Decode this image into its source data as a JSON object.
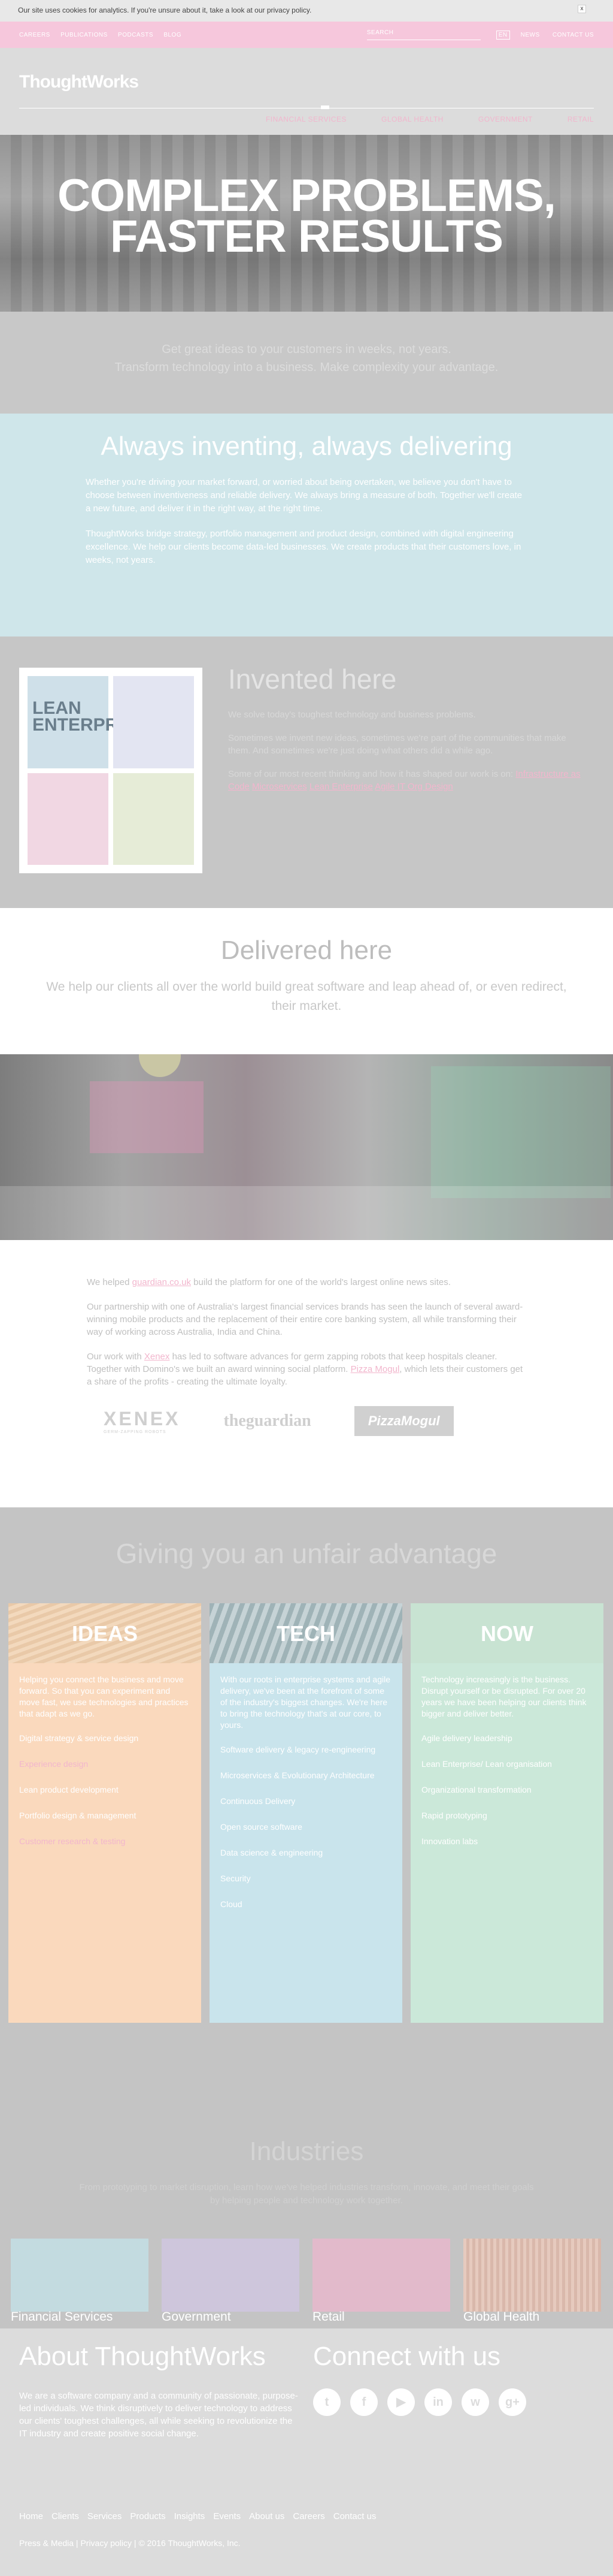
{
  "cookie": {
    "text": "Our site uses cookies for analytics. If you're unsure about it, take a look at our privacy policy.",
    "close": "x"
  },
  "topbar": {
    "left": [
      "Careers",
      "Publications",
      "Podcasts",
      "Blog"
    ],
    "search_placeholder": "Search",
    "right": [
      "News",
      "Contact us"
    ],
    "lang": "EN"
  },
  "header": {
    "logo": "ThoughtWorks",
    "nav": [
      "Financial Services",
      "Global Health",
      "Government",
      "Retail"
    ]
  },
  "hero": {
    "title_line1": "COMPLEX PROBLEMS,",
    "title_line2": "FASTER RESULTS"
  },
  "intro": {
    "line1": "Get great ideas to your customers in weeks, not years.",
    "line2": "Transform technology into a business. Make complexity your advantage."
  },
  "inventing": {
    "title": "Always inventing, always delivering",
    "p1": "Whether you're driving your market forward, or worried about being overtaken, we believe you don't have to choose between inventiveness and reliable delivery. We always bring a measure of both. Together we'll create a new future, and deliver it in the right way, at the right time.",
    "p2": "ThoughtWorks bridge strategy, portfolio management and product design, combined with digital engineering excellence. We help our clients become data-led businesses. We create products that their customers love, in weeks, not years."
  },
  "invented": {
    "title": "Invented here",
    "p1": "We solve today's toughest technology and business problems.",
    "p2": "Sometimes we invent new ideas, sometimes we're part of the communities that make them. And sometimes we're just doing what others did a while ago.",
    "p3": "Some of our most recent thinking and how it has shaped our work is on:",
    "links": [
      "Infrastructure as Code",
      "Microservices",
      "Lean Enterprise",
      "Agile IT Org Design"
    ],
    "book_title": "LEAN ENTERPRISE"
  },
  "delivered": {
    "title": "Delivered here",
    "text": "We help our clients all over the world build great software and leap ahead of, or even redirect, their market."
  },
  "clients": {
    "p1_pre": "We helped ",
    "p1_link": "guardian.co.uk",
    "p1_post": " build the platform for one of the world's largest online news sites.",
    "p2": "Our partnership with one of Australia's largest financial services brands has seen the launch of several award-winning mobile products and the replacement of their entire core banking system, all while transforming their way of working across Australia, India and China.",
    "p3_pre": "Our work with ",
    "p3_link1": "Xenex",
    "p3_mid": " has led to software advances for germ zapping robots that keep hospitals cleaner. Together with Domino's we built an award winning social platform. ",
    "p3_link2": "Pizza Mogul",
    "p3_post": ", which lets their customers get a share of the profits - creating the ultimate loyalty.",
    "logos": {
      "xenex": "XENEX",
      "xenex_sub": "GERM-ZAPPING ROBOTS",
      "guardian": "theguardian",
      "pizza": "PizzaMogul"
    }
  },
  "advantage": {
    "title": "Giving you an unfair advantage",
    "cards": [
      {
        "title": "IDEAS",
        "intro": "Helping you connect the business and move forward. So that you can experiment and move fast, we use technologies and practices that adapt as we go.",
        "items": [
          "Digital strategy & service design",
          "Experience design",
          "Lean product development",
          "Portfolio design & management",
          "Customer research & testing"
        ]
      },
      {
        "title": "TECH",
        "intro": "With our roots in enterprise systems and agile delivery, we've been at the forefront of some of the industry's biggest changes. We're here to bring the technology that's at our core, to yours.",
        "items": [
          "Software delivery & legacy re-engineering",
          "Microservices & Evolutionary Architecture",
          "Continuous Delivery",
          "Open source software",
          "Data science & engineering",
          "Security",
          "Cloud"
        ]
      },
      {
        "title": "NOW",
        "intro": "Technology increasingly is the business. Disrupt yourself or be disrupted. For over 20 years we have been helping our clients think bigger and deliver better.",
        "items": [
          "Agile delivery leadership",
          "Lean Enterprise/ Lean organisation",
          "Organizational transformation",
          "Rapid prototyping",
          "Innovation labs"
        ]
      }
    ]
  },
  "industries": {
    "title": "Industries",
    "text": "From prototyping to market disruption, learn how we've helped industries transform, innovate, and meet their goals by helping people and technology work together.",
    "tiles": [
      "Financial Services",
      "Government",
      "Retail",
      "Global Health"
    ]
  },
  "footer": {
    "about_title": "About ThoughtWorks",
    "about_text": "We are a software company and a community of passionate, purpose-led individuals. We think disruptively to deliver technology to address our clients' toughest challenges, all while seeking to revolutionize the IT industry and create positive social change.",
    "connect_title": "Connect with us",
    "social": [
      "t",
      "f",
      "▶",
      "in",
      "w",
      "g+"
    ],
    "links": [
      "Home",
      "Clients",
      "Services",
      "Products",
      "Insights",
      "Events",
      "About us",
      "Careers",
      "Contact us"
    ],
    "legal": "Press & Media  |  Privacy policy  |  © 2016 ThoughtWorks, Inc."
  }
}
